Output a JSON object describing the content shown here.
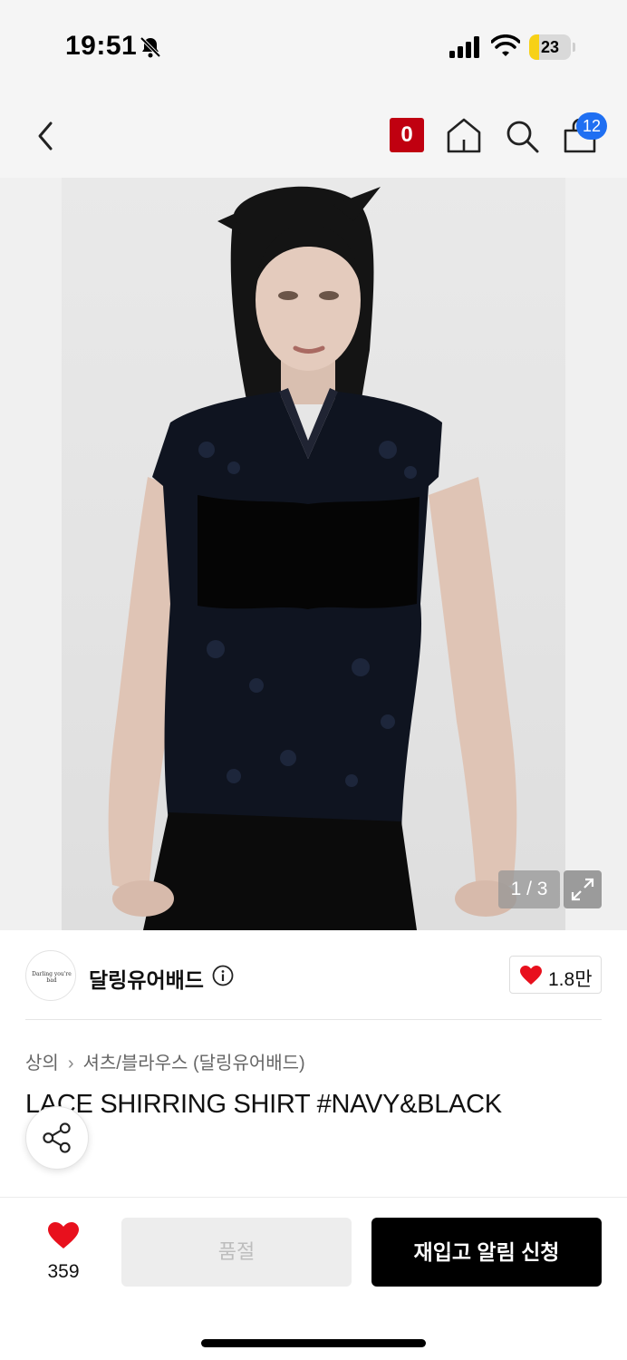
{
  "status_bar": {
    "time": "19:51",
    "battery_level": "23",
    "battery_fraction": 0.23,
    "icons": [
      "bell-slash-icon",
      "signal-icon",
      "wifi-icon",
      "battery-icon"
    ]
  },
  "nav": {
    "brand_badge": "0",
    "cart_count": "12",
    "icons": [
      "back-arrow-icon",
      "home-icon",
      "search-icon",
      "shopping-bag-icon"
    ],
    "badge_color": "#c00010",
    "cart_badge_color": "#1f6ff2"
  },
  "gallery": {
    "counter": "1 / 3",
    "expand_icon": "expand-icon"
  },
  "brand": {
    "logo_text": "Darling you're bad",
    "name": "달링유어배드",
    "likes": "1.8만"
  },
  "product": {
    "category": "상의",
    "subcategory": "셔츠/블라우스 (달링유어배드)",
    "title": "LACE SHIRRING SHIRT #NAVY&BLACK"
  },
  "bottom_bar": {
    "wish_count": "359",
    "soldout_label": "품절",
    "restock_label": "재입고 알림 신청",
    "heart_color": "#e8101d"
  }
}
